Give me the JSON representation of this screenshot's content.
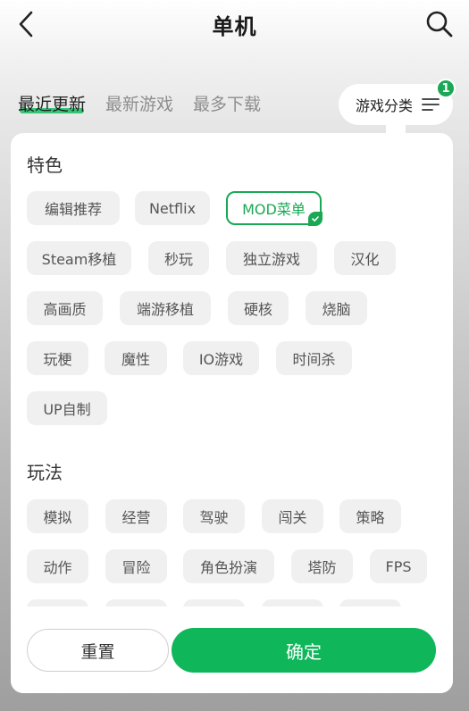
{
  "header": {
    "title": "单机",
    "back_icon": "chevron-left-icon",
    "search_icon": "search-icon"
  },
  "tabs": [
    {
      "label": "最近更新",
      "active": true
    },
    {
      "label": "最新游戏",
      "active": false
    },
    {
      "label": "最多下载",
      "active": false
    }
  ],
  "category": {
    "label": "游戏分类",
    "badge": "1",
    "icon": "filter-list-icon"
  },
  "sections": {
    "features": {
      "title": "特色",
      "chips": [
        "编辑推荐",
        "Netflix",
        "MOD菜单",
        "Steam移植",
        "秒玩",
        "独立游戏",
        "汉化",
        "高画质",
        "端游移植",
        "硬核",
        "烧脑",
        "玩梗",
        "魔性",
        "IO游戏",
        "时间杀",
        "UP自制"
      ],
      "selected": "MOD菜单"
    },
    "gameplay": {
      "title": "玩法",
      "chips": [
        "模拟",
        "经营",
        "驾驶",
        "闯关",
        "策略",
        "动作",
        "冒险",
        "角色扮演",
        "塔防",
        "FPS"
      ]
    }
  },
  "footer": {
    "reset_label": "重置",
    "confirm_label": "确定"
  },
  "colors": {
    "accent": "#0fb65a",
    "chip_bg": "#f0f0f0"
  }
}
